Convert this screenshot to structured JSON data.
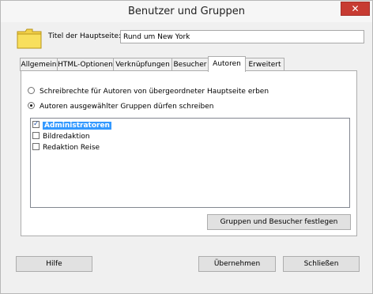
{
  "window": {
    "title": "Benutzer und Gruppen",
    "close_symbol": "✕"
  },
  "header": {
    "label": "Titel der Hauptseite:",
    "value": "Rund um New York"
  },
  "tabs": [
    {
      "label": "Allgemein"
    },
    {
      "label": "HTML-Optionen"
    },
    {
      "label": "Verknüpfungen"
    },
    {
      "label": "Besucher"
    },
    {
      "label": "Autoren",
      "active": true
    },
    {
      "label": "Erweitert"
    }
  ],
  "authors": {
    "option_inherit": "Schreibrechte für Autoren von übergeordneter Hauptseite erben",
    "option_groups": "Autoren ausgewählter Gruppen dürfen schreiben",
    "selected_option": "option_groups",
    "groups": [
      {
        "label": "Administratoren",
        "checked": true,
        "selected": true
      },
      {
        "label": "Bildredaktion",
        "checked": false
      },
      {
        "label": "Redaktion Reise",
        "checked": false
      }
    ],
    "set_groups_button": "Gruppen und Besucher festlegen"
  },
  "footer": {
    "help": "Hilfe",
    "apply": "Übernehmen",
    "close": "Schließen"
  }
}
